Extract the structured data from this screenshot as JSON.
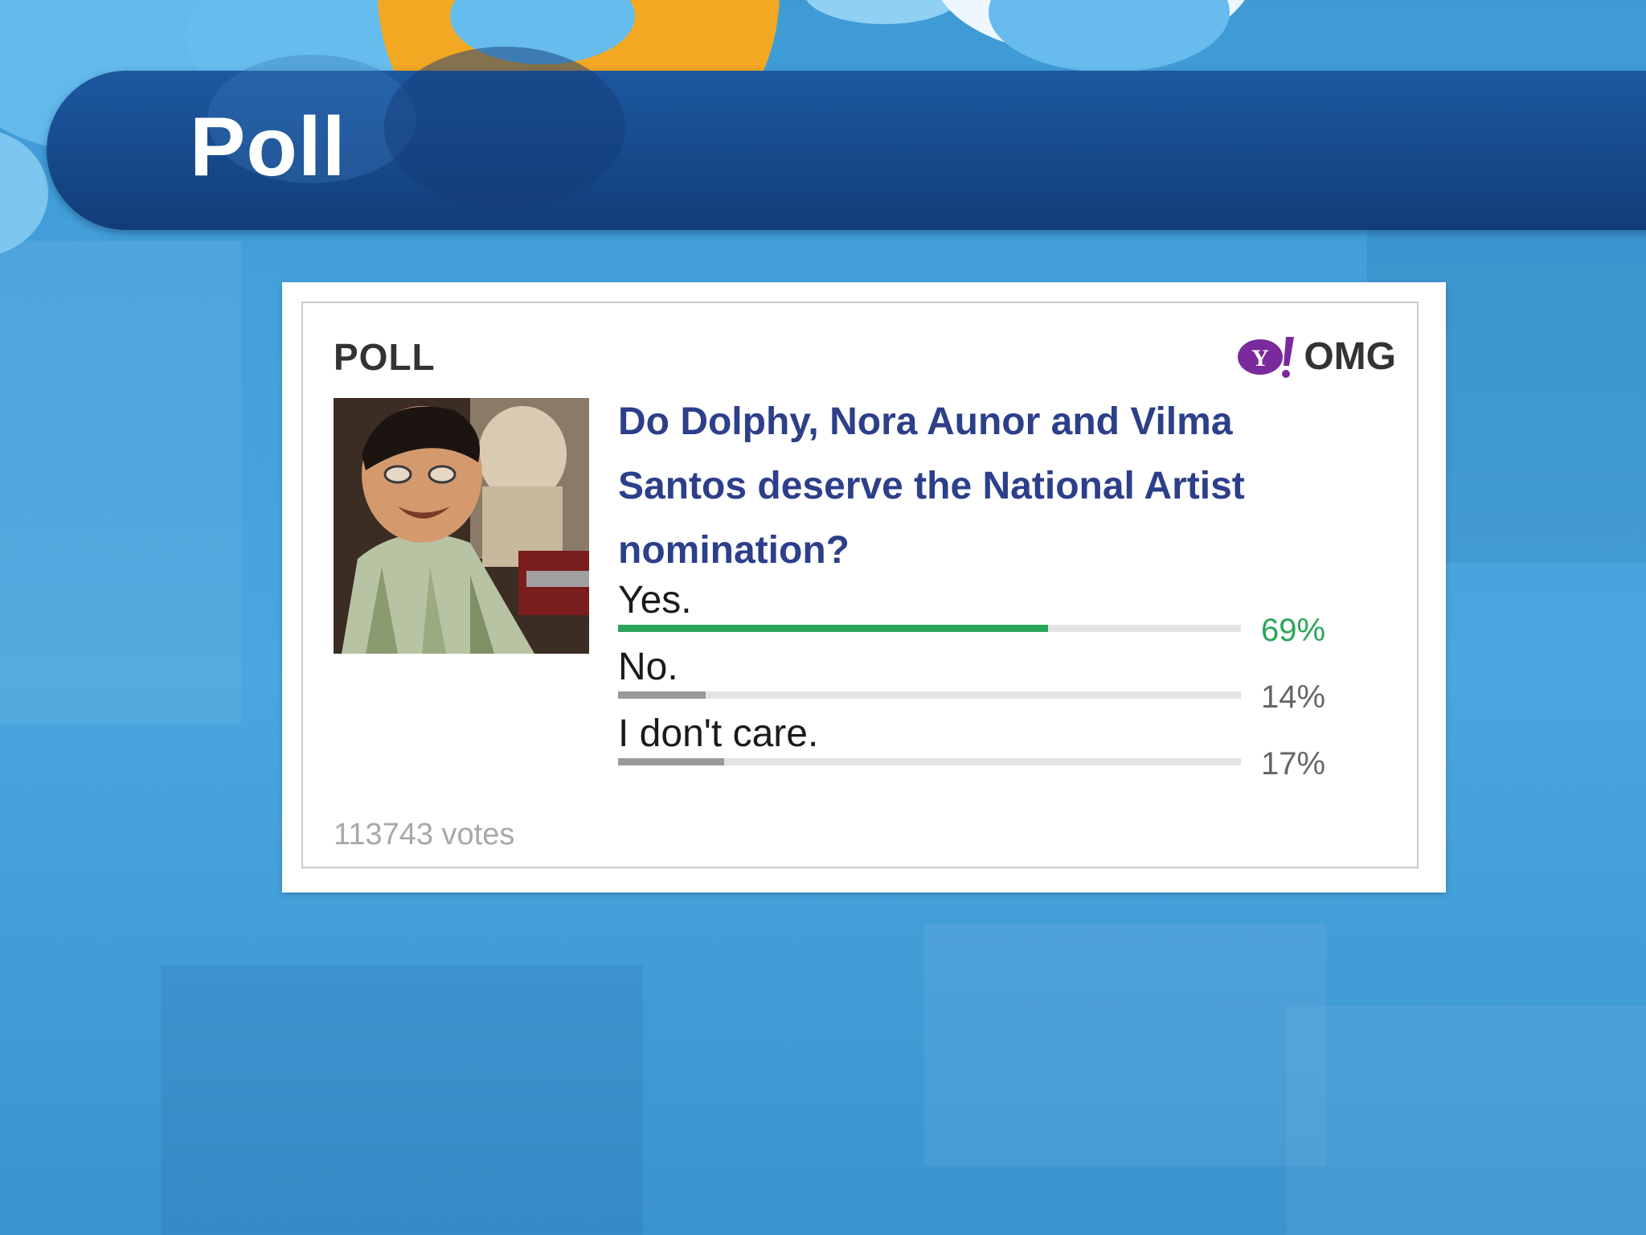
{
  "slide": {
    "title": "Poll"
  },
  "poll": {
    "heading": "POLL",
    "brand": "OMG",
    "brand_logo_icon": "yahoo-logo-icon",
    "photo_alt": "photo",
    "question": "Do Dolphy, Nora Aunor and Vilma Santos deserve the National Artist nomination?",
    "options": [
      {
        "label": "Yes.",
        "percent_text": "69%",
        "percent": 69,
        "color": "#2aa55a"
      },
      {
        "label": "No.",
        "percent_text": "14%",
        "percent": 14,
        "color": "#999999"
      },
      {
        "label": "I don't care.",
        "percent_text": "17%",
        "percent": 17,
        "color": "#999999"
      }
    ],
    "votes": "113743 votes"
  },
  "colors": {
    "background": "#4aa6de",
    "title_bar": "#164888",
    "question": "#2d3f8a",
    "leading_option": "#2aa55a"
  }
}
